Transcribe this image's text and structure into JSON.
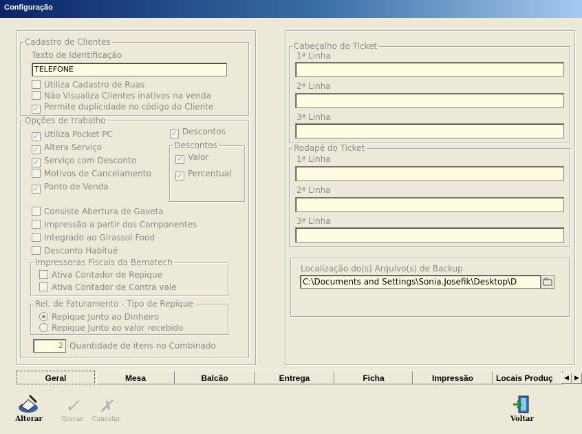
{
  "window": {
    "title": "Configuração"
  },
  "clientes": {
    "legend": "Cadastro de Clientes",
    "texto_label": "Texto de Identificação",
    "texto_value": "TELEFONE",
    "opts": [
      "Utiliza Cadastro de Ruas",
      "Não Visualiza Clientes inativos na venda",
      "Permite duplicidade no código do Cliente"
    ],
    "opts_checked": [
      false,
      false,
      true
    ]
  },
  "trabalho": {
    "legend": "Opções de trabalho",
    "opts": [
      "Utiliza Pocket PC",
      "Altera Serviço",
      "Serviço com Desconto",
      "Motivos de Cancelamento",
      "Ponto de Venda"
    ],
    "opts_checked": [
      true,
      true,
      true,
      false,
      true
    ],
    "descontos_label": "Descontos",
    "descontos_checked": true,
    "descontos_group": "Descontos",
    "valor": "Valor",
    "percentual": "Percentual",
    "opts2": [
      "Consiste Abertura de Gaveta",
      "Impressão a partir dos Componentes",
      "Integrado ao Girassol Food",
      "Desconto Habitué"
    ]
  },
  "bematech": {
    "legend": "Impressoras Fiscais da Bematech",
    "opts": [
      "Ativa Contador de Repique",
      "Ativa Contador de Contra vale"
    ]
  },
  "faturamento": {
    "legend": "Rel. de Faturamento - Tipo de Repique",
    "opts": [
      "Repique Junto ao Dinheiro",
      "Repique Junto ao valor recebido"
    ]
  },
  "combinado": {
    "value": "2",
    "label": "Quantidade de itens no Combinado"
  },
  "cabecalho": {
    "legend": "Cabeçalho do Ticket",
    "l1": "1ª Linha",
    "l2": "2ª Linha",
    "l3": "3ª Linha"
  },
  "rodape": {
    "legend": "Rodapé do Ticket",
    "l1": "1ª Linha",
    "l2": "2ª Linha",
    "l3": "3ª Linha"
  },
  "backup": {
    "legend": "Localização do(s) Arquivo(s) de Backup",
    "path": "C:\\Documents and Settings\\Sonia.Josefik\\Desktop\\D"
  },
  "tabs": [
    "Geral",
    "Mesa",
    "Balcão",
    "Entrega",
    "Ficha",
    "Impressão",
    "Locais Produç"
  ],
  "toolbar": {
    "alterar": "Alterar",
    "gravar": "Gravar",
    "cancelar": "Cancelar",
    "voltar": "Voltar"
  }
}
